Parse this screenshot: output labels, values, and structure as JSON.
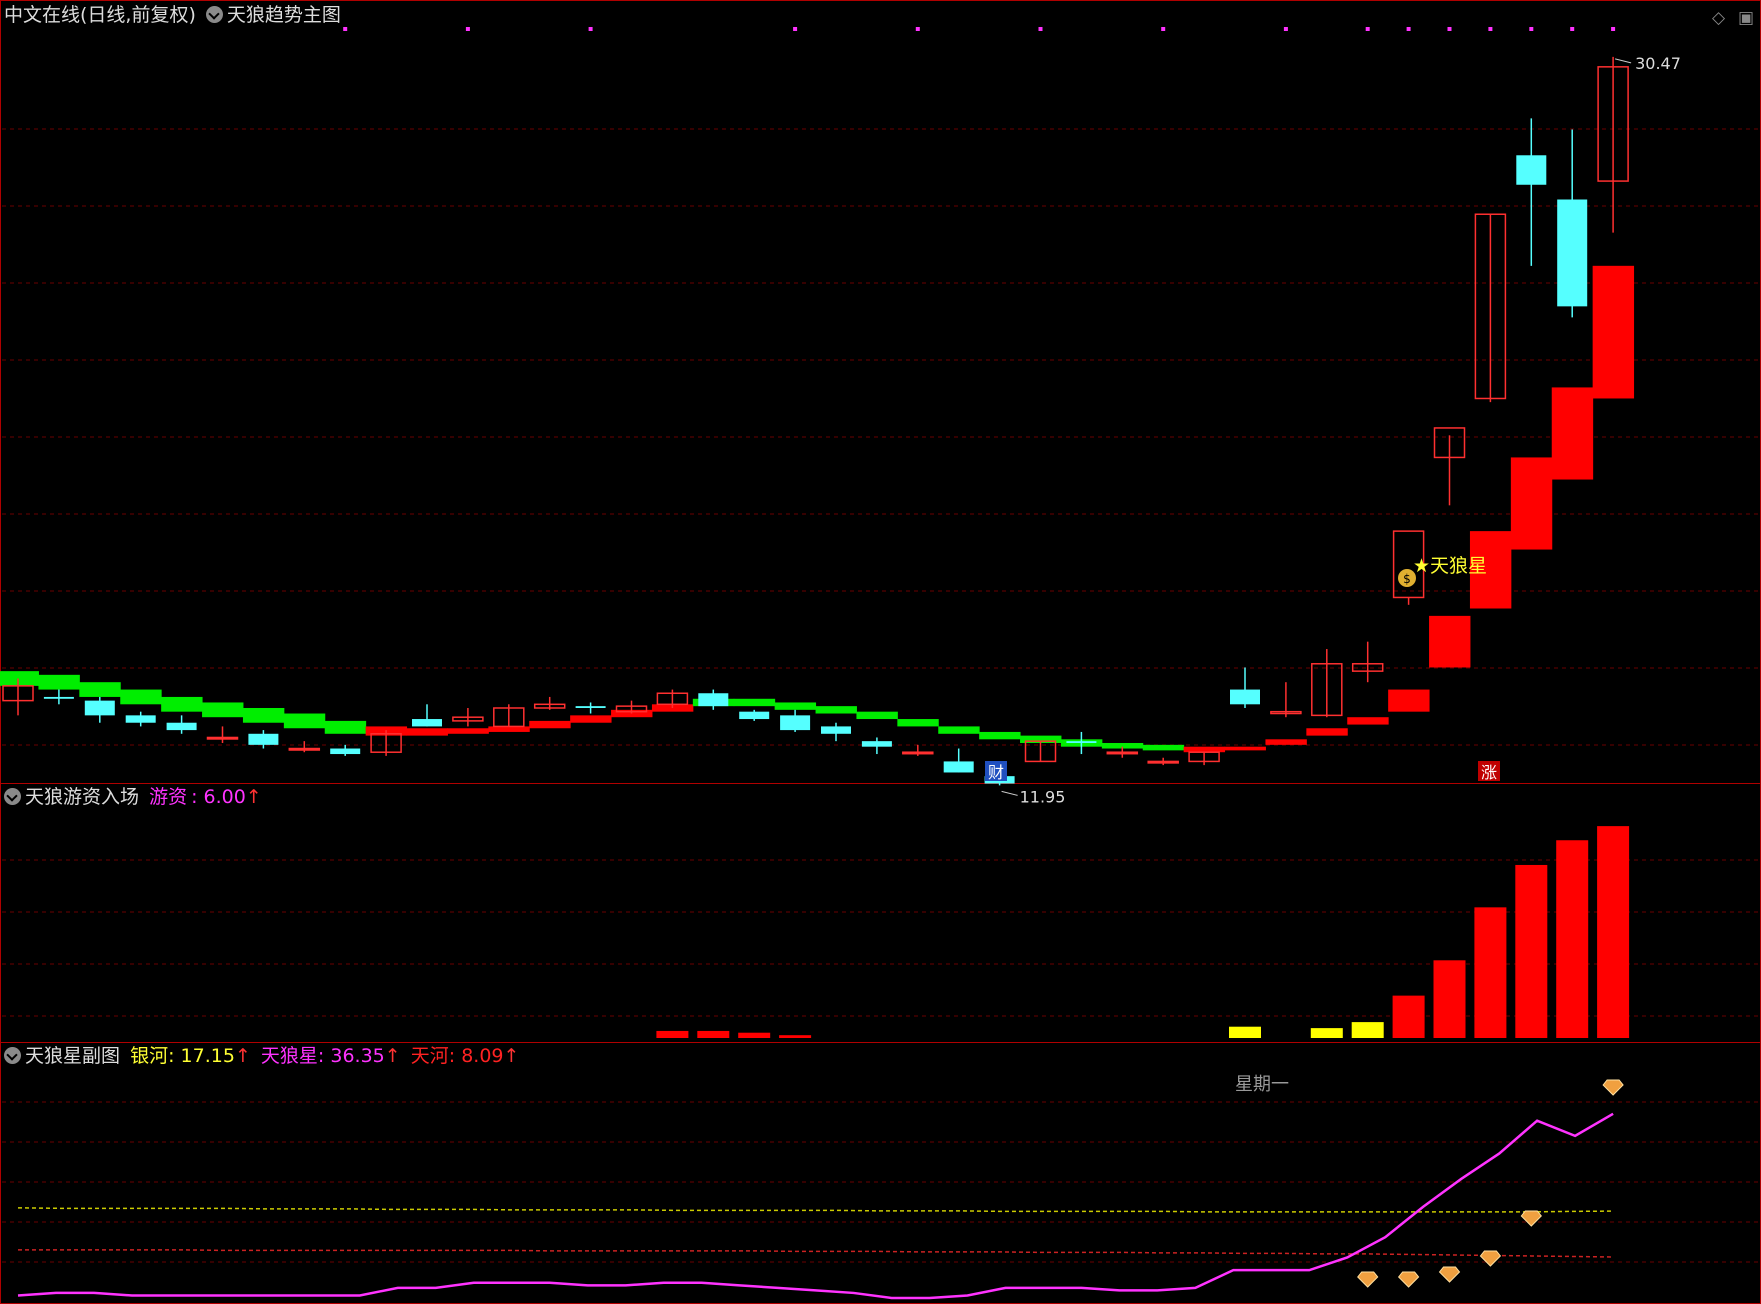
{
  "main_header": {
    "title": "中文在线(日线,前复权)",
    "indicator": "天狼趋势主图"
  },
  "sub1_header": {
    "name": "天狼游资入场",
    "label": "游资",
    "value": "6.00",
    "arrow": "↑"
  },
  "sub2_header": {
    "name": "天狼星副图",
    "s1_label": "银河",
    "s1_value": "17.15",
    "s2_label": "天狼星",
    "s2_value": "36.35",
    "s3_label": "天河",
    "s3_value": "8.09",
    "arrow": "↑"
  },
  "annotations": {
    "high_label": "30.47",
    "low_label": "11.95",
    "signal_label": "★天狼星",
    "cai_tag": "财",
    "zhang_tag": "涨",
    "weekday": "星期一"
  },
  "colors": {
    "up_candle": "#ff3030",
    "down_candle": "#55ffff",
    "band_up": "#ff0000",
    "band_down": "#00ee00",
    "flow_red": "#ff0000",
    "flow_yellow": "#ffff00",
    "line_magenta": "#ff33ff",
    "line_yellow": "#cccc00",
    "line_red": "#cc2222",
    "grid": "#6a0000"
  },
  "chart_data": [
    {
      "type": "candlestick",
      "title": "中文在线(日线,前复权)",
      "ylim": [
        10.9,
        31.2
      ],
      "candles": [
        {
          "o": 13.0,
          "h": 13.6,
          "l": 12.6,
          "c": 13.4
        },
        {
          "o": 13.1,
          "h": 13.3,
          "l": 12.9,
          "c": 13.05
        },
        {
          "o": 13.0,
          "h": 13.1,
          "l": 12.4,
          "c": 12.6
        },
        {
          "o": 12.6,
          "h": 12.7,
          "l": 12.3,
          "c": 12.4
        },
        {
          "o": 12.4,
          "h": 12.6,
          "l": 12.1,
          "c": 12.2
        },
        {
          "o": 12.0,
          "h": 12.3,
          "l": 11.85,
          "c": 12.0
        },
        {
          "o": 12.1,
          "h": 12.2,
          "l": 11.7,
          "c": 11.8
        },
        {
          "o": 11.7,
          "h": 11.9,
          "l": 11.6,
          "c": 11.7
        },
        {
          "o": 11.7,
          "h": 11.8,
          "l": 11.5,
          "c": 11.55
        },
        {
          "o": 11.6,
          "h": 12.2,
          "l": 11.5,
          "c": 12.1
        },
        {
          "o": 12.5,
          "h": 12.9,
          "l": 12.3,
          "c": 12.3
        },
        {
          "o": 12.45,
          "h": 12.8,
          "l": 12.3,
          "c": 12.55
        },
        {
          "o": 12.3,
          "h": 12.9,
          "l": 12.3,
          "c": 12.8
        },
        {
          "o": 12.8,
          "h": 13.1,
          "l": 12.75,
          "c": 12.9
        },
        {
          "o": 12.85,
          "h": 12.95,
          "l": 12.65,
          "c": 12.8
        },
        {
          "o": 12.7,
          "h": 13.0,
          "l": 12.65,
          "c": 12.85
        },
        {
          "o": 12.9,
          "h": 13.3,
          "l": 12.8,
          "c": 13.2
        },
        {
          "o": 13.2,
          "h": 13.3,
          "l": 12.75,
          "c": 12.85
        },
        {
          "o": 12.7,
          "h": 12.75,
          "l": 12.45,
          "c": 12.5
        },
        {
          "o": 12.6,
          "h": 12.75,
          "l": 12.15,
          "c": 12.2
        },
        {
          "o": 12.3,
          "h": 12.4,
          "l": 11.9,
          "c": 12.1
        },
        {
          "o": 11.9,
          "h": 12.0,
          "l": 11.55,
          "c": 11.75
        },
        {
          "o": 11.6,
          "h": 11.8,
          "l": 11.5,
          "c": 11.6
        },
        {
          "o": 11.35,
          "h": 11.7,
          "l": 11.05,
          "c": 11.05
        },
        {
          "o": 10.95,
          "h": 11.05,
          "l": 10.7,
          "c": 10.75
        },
        {
          "o": 11.35,
          "h": 11.9,
          "l": 11.35,
          "c": 11.9
        },
        {
          "o": 11.9,
          "h": 12.15,
          "l": 11.55,
          "c": 11.85
        },
        {
          "o": 11.6,
          "h": 11.75,
          "l": 11.45,
          "c": 11.6
        },
        {
          "o": 11.35,
          "h": 11.45,
          "l": 11.25,
          "c": 11.35
        },
        {
          "o": 11.35,
          "h": 11.6,
          "l": 11.25,
          "c": 11.6
        },
        {
          "o": 13.3,
          "h": 13.9,
          "l": 12.8,
          "c": 12.9
        },
        {
          "o": 12.65,
          "h": 13.5,
          "l": 12.55,
          "c": 12.7
        },
        {
          "o": 12.6,
          "h": 14.4,
          "l": 12.55,
          "c": 14.0
        },
        {
          "o": 13.8,
          "h": 14.6,
          "l": 13.5,
          "c": 14.0
        },
        {
          "o": 15.8,
          "h": 15.8,
          "l": 15.6,
          "c": 17.6
        },
        {
          "o": 19.6,
          "h": 20.2,
          "l": 18.3,
          "c": 20.4
        },
        {
          "o": 21.2,
          "h": 26.2,
          "l": 21.1,
          "c": 26.2
        },
        {
          "o": 27.8,
          "h": 28.8,
          "l": 24.8,
          "c": 27.0
        },
        {
          "o": 26.6,
          "h": 28.5,
          "l": 23.4,
          "c": 23.7
        },
        {
          "o": 27.1,
          "h": 30.47,
          "l": 25.7,
          "c": 30.2
        }
      ]
    },
    {
      "type": "band",
      "name": "天狼趋势",
      "lo": [
        13.4,
        13.3,
        13.1,
        12.9,
        12.7,
        12.55,
        12.4,
        12.25,
        12.1,
        12.05,
        12.05,
        12.1,
        12.15,
        12.25,
        12.4,
        12.55,
        12.7,
        12.85,
        12.85,
        12.75,
        12.65,
        12.5,
        12.3,
        12.1,
        11.95,
        11.85,
        11.75,
        11.7,
        11.65,
        11.6,
        11.65,
        11.8,
        12.05,
        12.35,
        12.7,
        13.9,
        15.5,
        17.1,
        19.0,
        21.2
      ],
      "hi": [
        13.8,
        13.7,
        13.5,
        13.3,
        13.1,
        12.95,
        12.8,
        12.65,
        12.45,
        12.3,
        12.25,
        12.25,
        12.3,
        12.45,
        12.6,
        12.75,
        12.9,
        13.05,
        13.05,
        12.95,
        12.85,
        12.7,
        12.5,
        12.3,
        12.15,
        12.05,
        11.95,
        11.85,
        11.8,
        11.75,
        11.75,
        11.95,
        12.25,
        12.55,
        13.3,
        15.3,
        17.6,
        19.6,
        21.5,
        24.8
      ],
      "trend": [
        "d",
        "d",
        "d",
        "d",
        "d",
        "d",
        "d",
        "d",
        "d",
        "u",
        "u",
        "u",
        "u",
        "u",
        "u",
        "u",
        "u",
        "d",
        "d",
        "d",
        "d",
        "d",
        "d",
        "d",
        "d",
        "d",
        "d",
        "d",
        "d",
        "u",
        "u",
        "u",
        "u",
        "u",
        "u",
        "u",
        "u",
        "u",
        "u",
        "u"
      ]
    },
    {
      "type": "bar",
      "title": "天狼游资入场",
      "ylim": [
        0,
        6.4
      ],
      "values": [
        0,
        0,
        0,
        0,
        0,
        0,
        0,
        0,
        0,
        0,
        0,
        0,
        0,
        0,
        0,
        0,
        0.2,
        0.2,
        0.15,
        0.08,
        0,
        0,
        0,
        0,
        0,
        0,
        0,
        0,
        0,
        0,
        0.32,
        0,
        0.28,
        0.45,
        1.2,
        2.2,
        3.7,
        4.9,
        5.6,
        6.0
      ],
      "colors": [
        "r",
        "r",
        "r",
        "r",
        "r",
        "r",
        "r",
        "r",
        "r",
        "r",
        "r",
        "r",
        "r",
        "r",
        "r",
        "r",
        "r",
        "r",
        "r",
        "r",
        "r",
        "r",
        "r",
        "r",
        "r",
        "r",
        "r",
        "r",
        "r",
        "r",
        "y",
        "y",
        "y",
        "y",
        "r",
        "r",
        "r",
        "r",
        "r",
        "r"
      ]
    },
    {
      "type": "line",
      "title": "天狼星副图",
      "ylim": [
        0,
        45
      ],
      "series": [
        {
          "name": "银河",
          "values": [
            17.8,
            17.7,
            17.7,
            17.7,
            17.7,
            17.7,
            17.6,
            17.6,
            17.6,
            17.5,
            17.5,
            17.5,
            17.4,
            17.4,
            17.4,
            17.4,
            17.3,
            17.3,
            17.3,
            17.3,
            17.3,
            17.2,
            17.2,
            17.2,
            17.1,
            17.1,
            17.1,
            17.1,
            17.1,
            17.0,
            17.0,
            17.0,
            17.0,
            17.0,
            17.0,
            17.0,
            17.0,
            17.0,
            17.1,
            17.15
          ]
        },
        {
          "name": "天河",
          "values": [
            9.5,
            9.5,
            9.5,
            9.5,
            9.5,
            9.4,
            9.4,
            9.4,
            9.4,
            9.4,
            9.4,
            9.4,
            9.4,
            9.3,
            9.3,
            9.3,
            9.3,
            9.3,
            9.3,
            9.2,
            9.2,
            9.2,
            9.1,
            9.1,
            9.1,
            9.0,
            9.0,
            9.0,
            8.9,
            8.9,
            8.8,
            8.8,
            8.7,
            8.7,
            8.6,
            8.5,
            8.4,
            8.3,
            8.2,
            8.09
          ]
        },
        {
          "name": "天狼星",
          "values": [
            0.5,
            1,
            1,
            0.5,
            0.5,
            0.5,
            0.5,
            0.5,
            0.5,
            0.5,
            2,
            2,
            3,
            3,
            3,
            2.5,
            2.5,
            3,
            3,
            2.5,
            2,
            1.5,
            1,
            0,
            0,
            0.5,
            2,
            2,
            2,
            1.5,
            1.5,
            2,
            5.5,
            5.5,
            5.5,
            8,
            12,
            18,
            23.5,
            28.5,
            35,
            32,
            36.35
          ]
        }
      ],
      "signals": [
        33,
        34,
        35,
        36,
        37,
        39
      ],
      "weekday_label": "星期一"
    }
  ]
}
